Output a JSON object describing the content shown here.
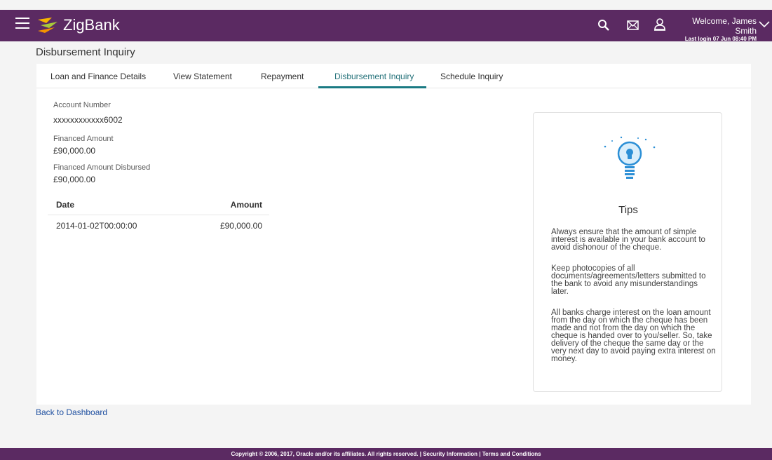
{
  "header": {
    "brand": "ZigBank",
    "welcome": "Welcome, James Smith",
    "last_login": "Last login 07 Jun 08:40 PM",
    "icons": [
      "menu-icon",
      "search-icon",
      "mail-icon",
      "user-icon",
      "chevron-down-icon"
    ],
    "brand_color": "#5b2a62"
  },
  "page": {
    "title": "Disbursement Inquiry"
  },
  "tabs": [
    {
      "label": "Loan and Finance Details"
    },
    {
      "label": "View Statement"
    },
    {
      "label": "Repayment"
    },
    {
      "label": "Disbursement Inquiry",
      "active": true
    },
    {
      "label": "Schedule Inquiry"
    }
  ],
  "details": {
    "account_number_label": "Account Number",
    "account_number_value": "xxxxxxxxxxxx6002",
    "financed_amount_label": "Financed Amount",
    "financed_amount_value": "£90,000.00",
    "disbursed_label": "Financed Amount Disbursed",
    "disbursed_value": "£90,000.00"
  },
  "table": {
    "columns": [
      "Date",
      "Amount"
    ],
    "rows": [
      {
        "date": "2014-01-02T00:00:00",
        "amount": "£90,000.00"
      }
    ]
  },
  "tips": {
    "title": "Tips",
    "items": [
      "Always ensure that the amount of simple interest is available in your bank account to avoid dishonour of the cheque.",
      "Keep photocopies of all documents/agreements/letters submitted to the bank to avoid any misunderstandings later.",
      "All banks charge interest on the loan amount from the day on which the cheque has been made and not from the day on which the cheque is handed over to you/seller. So, take delivery of the cheque the same day or the very next day to avoid paying extra interest on money."
    ]
  },
  "back_link": "Back to Dashboard",
  "footer": {
    "copyright": "Copyright © 2006, 2017, Oracle and/or its affiliates. All rights reserved.",
    "separator": "|",
    "security": "Security Information",
    "terms": "Terms and Conditions"
  }
}
